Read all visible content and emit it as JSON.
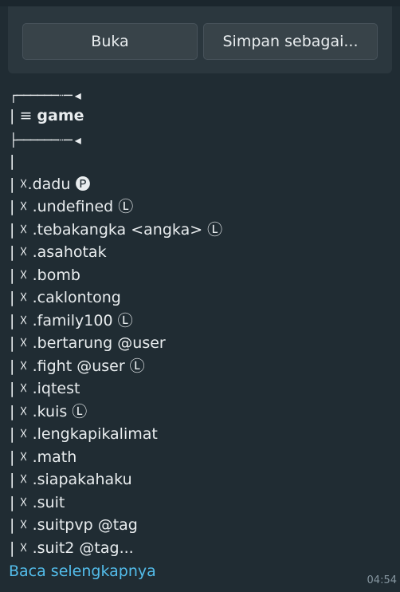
{
  "actions": {
    "open_label": "Buka",
    "save_label": "Simpan sebagai..."
  },
  "message": {
    "box_top": "┌──────┈─ ◂",
    "title_prefix": "| ≡",
    "title": "game",
    "box_bottom": "├──────┈─ ◂",
    "separator": "|",
    "items": [
      "| ☓.dadu 🅟",
      "| ☓ .undefined Ⓛ",
      "| ☓ .tebakangka <angka> Ⓛ",
      "| ☓ .asahotak",
      "| ☓ .bomb",
      "| ☓ .caklontong",
      "| ☓ .family100 Ⓛ",
      "| ☓ .bertarung @user",
      "| ☓ .fight @user Ⓛ",
      "| ☓ .iqtest",
      "| ☓ .kuis Ⓛ",
      "| ☓ .lengkapikalimat",
      "| ☓ .math",
      "| ☓ .siapakahaku",
      "| ☓ .suit",
      "| ☓ .suitpvp @tag",
      "| ☓ .suit2 @tag..."
    ],
    "read_more": "Baca selengkapnya",
    "time": "04:54"
  }
}
